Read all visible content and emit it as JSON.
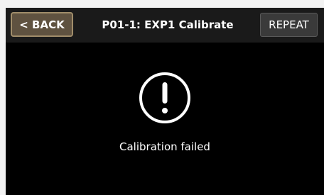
{
  "header": {
    "back_label": "< BACK",
    "title": "P01-1: EXP1 Calibrate",
    "repeat_label": "REPEAT"
  },
  "status": {
    "icon": "exclamation-circle-icon",
    "message": "Calibration failed"
  },
  "colors": {
    "screen_background": "#000000",
    "header_background": "#1a1a1a",
    "back_button_fill": "#5f5240",
    "back_button_border": "#a08d6a",
    "repeat_button_fill": "#3a3a3a",
    "text": "#ffffff"
  }
}
